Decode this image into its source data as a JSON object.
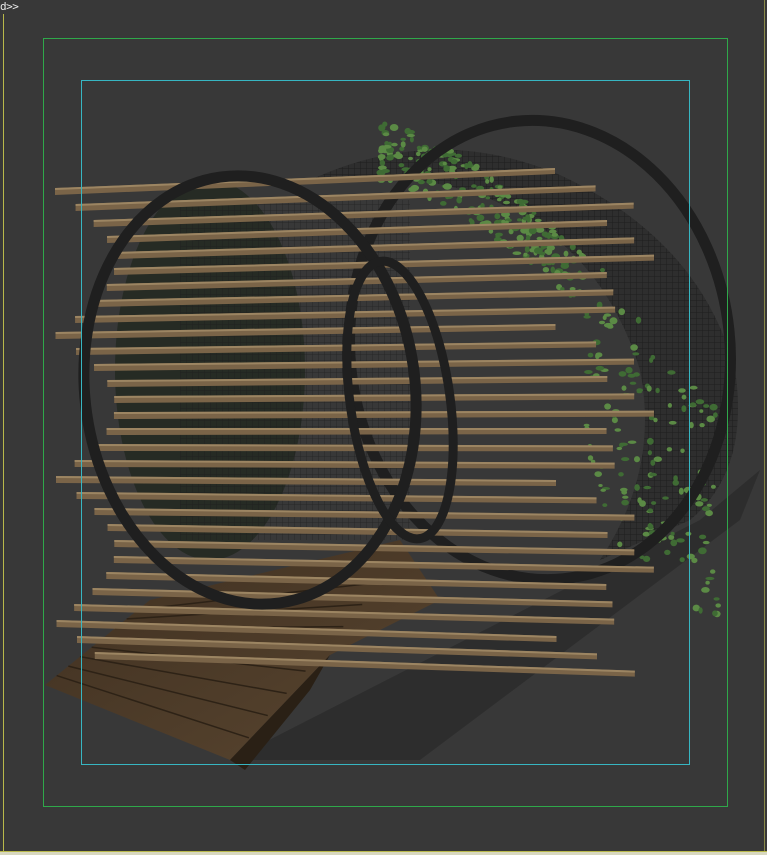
{
  "viewport": {
    "label": "d>>",
    "background_color": "#383838",
    "border_color": "#b8b84a",
    "safe_frame_outer_color": "#2fa84a",
    "safe_frame_inner_color": "#37b6c2"
  },
  "scene": {
    "object": "wooden-ring-tunnel-pergola",
    "colors": {
      "slat": "#7a6448",
      "slat_top": "#9c8562",
      "ring": "#222222",
      "mesh": "#2a2a2a",
      "deck": "#4d3b28",
      "deck_dark": "#3e2f20",
      "ivy": "#3f6b34",
      "ivy_light": "#5b8a45"
    }
  }
}
